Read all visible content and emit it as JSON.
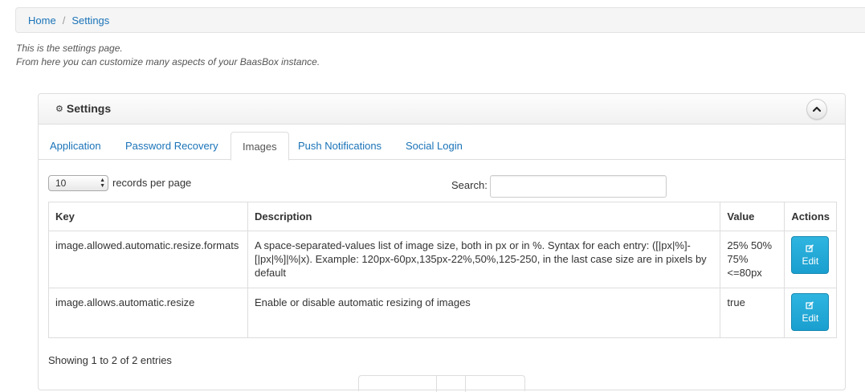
{
  "breadcrumb": {
    "home": "Home",
    "separator": "/",
    "current": "Settings"
  },
  "intro": {
    "line1": "This is the settings page.",
    "line2": "From here you can customize many aspects of your BaasBox instance."
  },
  "box": {
    "title": "Settings",
    "title_icon": "gear-icon",
    "collapse_icon": "chevron-up-icon"
  },
  "tabs": [
    {
      "label": "Application"
    },
    {
      "label": "Password Recovery"
    },
    {
      "label": "Images",
      "active": true
    },
    {
      "label": "Push Notifications"
    },
    {
      "label": "Social Login"
    }
  ],
  "controls": {
    "page_length": "10",
    "page_length_label": "records per page",
    "search_label": "Search:",
    "search_value": ""
  },
  "table": {
    "headers": {
      "key": "Key",
      "description": "Description",
      "value": "Value",
      "actions": "Actions"
    },
    "rows": [
      {
        "key": "image.allowed.automatic.resize.formats",
        "description": "A space-separated-values list of image size, both in px or in %. Syntax for each entry: ([|px|%]-[|px|%]|%|x). Example: 120px-60px,135px-22%,50%,125-250, in the last case size are in pixels by default",
        "value": "25% 50% 75% <=80px",
        "action": "Edit"
      },
      {
        "key": "image.allows.automatic.resize",
        "description": "Enable or disable automatic resizing of images",
        "value": "true",
        "action": "Edit"
      }
    ]
  },
  "info": "Showing 1 to 2 of 2 entries",
  "colors": {
    "link": "#1a73b8",
    "edit_button": "#1a9fcf",
    "border": "#dddddd"
  }
}
